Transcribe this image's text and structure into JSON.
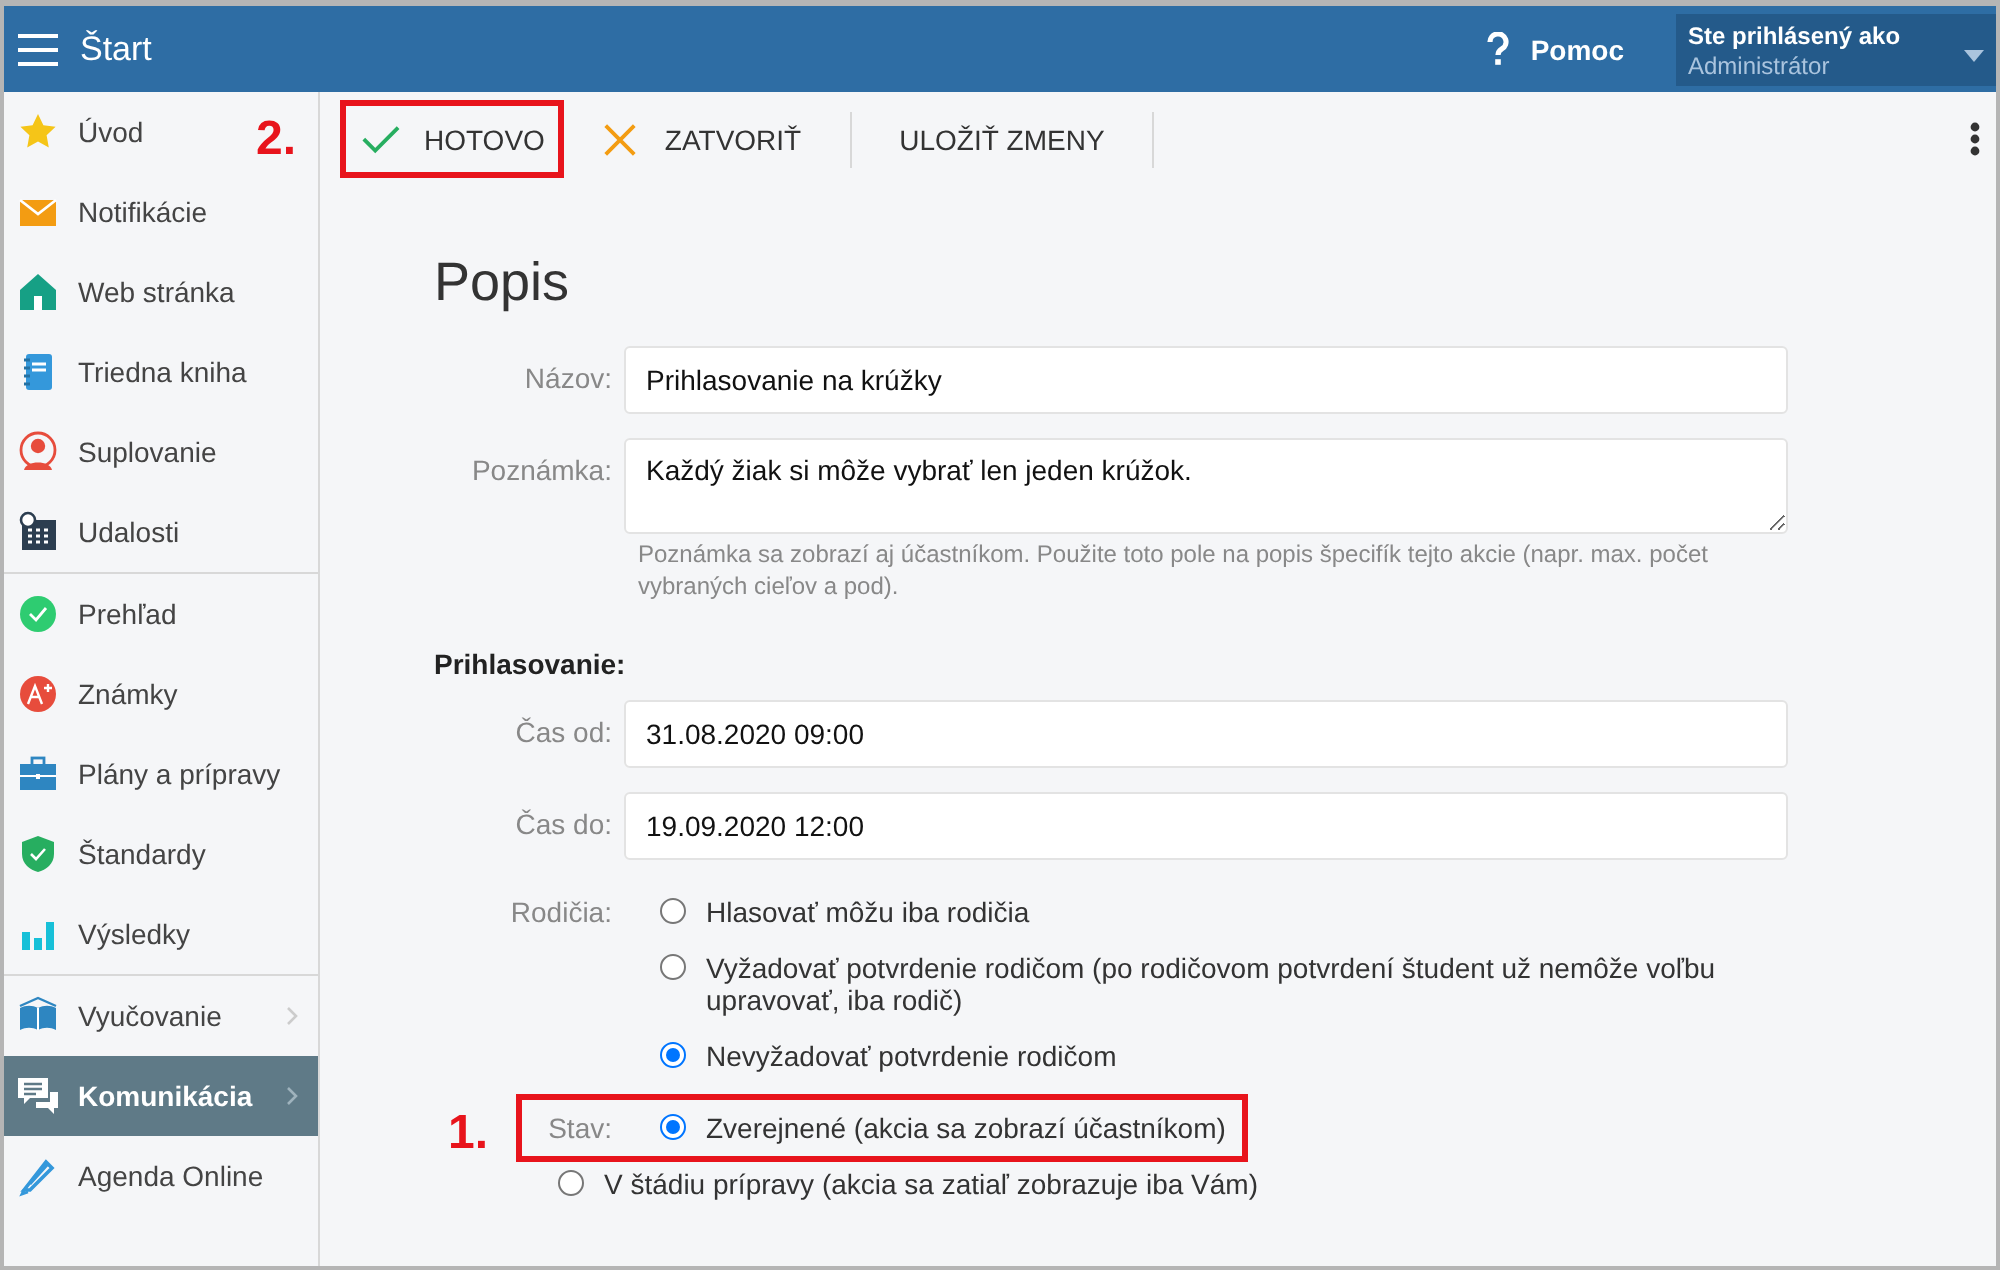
{
  "topbar": {
    "title": "Štart",
    "help": "Pomoc",
    "user_caption": "Ste prihlásený ako",
    "user_role": "Administrátor"
  },
  "sidebar": {
    "groups": [
      {
        "items": [
          {
            "label": "Úvod",
            "selected": false,
            "has_submenu": false
          },
          {
            "label": "Notifikácie",
            "selected": false,
            "has_submenu": false
          },
          {
            "label": "Web stránka",
            "selected": false,
            "has_submenu": false
          },
          {
            "label": "Triedna kniha",
            "selected": false,
            "has_submenu": false
          },
          {
            "label": "Suplovanie",
            "selected": false,
            "has_submenu": false
          },
          {
            "label": "Udalosti",
            "selected": false,
            "has_submenu": false
          }
        ]
      },
      {
        "items": [
          {
            "label": "Prehľad",
            "selected": false,
            "has_submenu": false
          },
          {
            "label": "Známky",
            "selected": false,
            "has_submenu": false
          },
          {
            "label": "Plány a prípravy",
            "selected": false,
            "has_submenu": false
          },
          {
            "label": "Štandardy",
            "selected": false,
            "has_submenu": false
          },
          {
            "label": "Výsledky",
            "selected": false,
            "has_submenu": false
          }
        ]
      },
      {
        "items": [
          {
            "label": "Vyučovanie",
            "selected": false,
            "has_submenu": true
          },
          {
            "label": "Komunikácia",
            "selected": true,
            "has_submenu": true
          },
          {
            "label": "Agenda Online",
            "selected": false,
            "has_submenu": false
          }
        ]
      }
    ]
  },
  "toolbar": {
    "buttons": [
      {
        "kind": "done",
        "label": "HOTOVO",
        "callout": "2."
      },
      {
        "kind": "close",
        "label": "ZATVORIŤ"
      },
      {
        "kind": "save",
        "label": "ULOŽIŤ ZMENY"
      }
    ]
  },
  "form": {
    "heading": "Popis",
    "name": {
      "label": "Názov:",
      "value": "Prihlasovanie na krúžky"
    },
    "note": {
      "label": "Poznámka:",
      "value": "Každý žiak si môže vybrať len jeden krúžok.",
      "hint": "Poznámka sa zobrazí aj účastníkom. Použite toto pole na popis špecifík tejto akcie (napr. max. počet vybraných cieľov a pod)."
    },
    "section": "Prihlasovanie:",
    "time_from": {
      "label": "Čas od:",
      "value": "31.08.2020 09:00"
    },
    "time_to": {
      "label": "Čas do:",
      "value": "19.09.2020 12:00"
    },
    "parents": {
      "label": "Rodičia:",
      "options": [
        {
          "label": "Hlasovať môžu iba rodičia",
          "selected": false
        },
        {
          "label": "Vyžadovať potvrdenie rodičom (po rodičovom potvrdení študent už nemôže voľbu upravovať, iba rodič)",
          "selected": false
        },
        {
          "label": "Nevyžadovať potvrdenie rodičom",
          "selected": true
        }
      ]
    },
    "status": {
      "label": "Stav:",
      "callout": "1.",
      "options": [
        {
          "label": "Zverejnené (akcia sa zobrazí účastníkom)",
          "selected": true
        },
        {
          "label": "V štádiu prípravy (akcia sa zatiaľ zobrazuje iba Vám)",
          "selected": false
        }
      ]
    }
  }
}
